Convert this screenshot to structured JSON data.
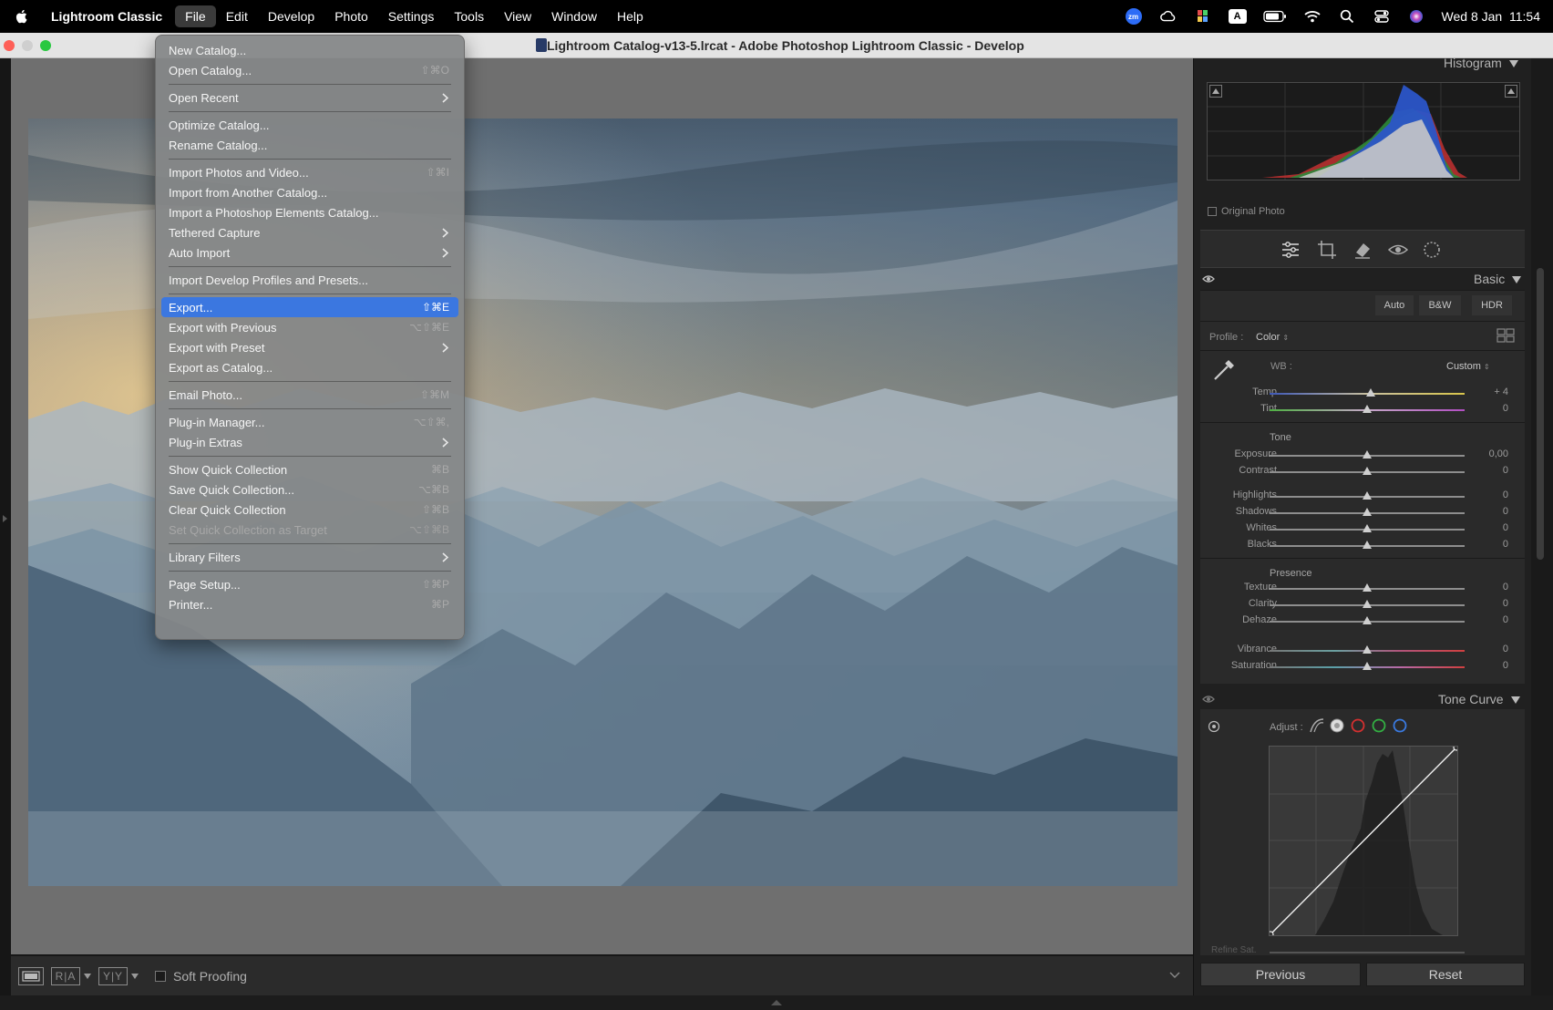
{
  "menubar": {
    "app_name": "Lightroom Classic",
    "items": [
      "File",
      "Edit",
      "Develop",
      "Photo",
      "Settings",
      "Tools",
      "View",
      "Window",
      "Help"
    ],
    "active_item": "File",
    "status_icons": [
      "zoom-icon",
      "creative-cloud-icon",
      "color-app-icon",
      "input-source-icon",
      "battery-icon",
      "wifi-icon",
      "spotlight-search-icon",
      "control-center-icon",
      "siri-icon"
    ],
    "input_source_label": "A",
    "zoom_label": "zm",
    "clock": "Wed 8 Jan  11:54"
  },
  "window": {
    "title": "Lightroom Catalog-v13-5.lrcat - Adobe Photoshop Lightroom Classic - Develop"
  },
  "file_menu": {
    "groups": [
      [
        {
          "label": "New Catalog...",
          "shortcut": ""
        },
        {
          "label": "Open Catalog...",
          "shortcut": "⇧⌘O"
        }
      ],
      [
        {
          "label": "Open Recent",
          "shortcut": "",
          "submenu": true
        }
      ],
      [
        {
          "label": "Optimize Catalog...",
          "shortcut": ""
        },
        {
          "label": "Rename Catalog...",
          "shortcut": ""
        }
      ],
      [
        {
          "label": "Import Photos and Video...",
          "shortcut": "⇧⌘I"
        },
        {
          "label": "Import from Another Catalog...",
          "shortcut": ""
        },
        {
          "label": "Import a Photoshop Elements Catalog...",
          "shortcut": ""
        },
        {
          "label": "Tethered Capture",
          "shortcut": "",
          "submenu": true
        },
        {
          "label": "Auto Import",
          "shortcut": "",
          "submenu": true
        }
      ],
      [
        {
          "label": "Import Develop Profiles and Presets...",
          "shortcut": ""
        }
      ],
      [
        {
          "label": "Export...",
          "shortcut": "⇧⌘E",
          "highlighted": true
        },
        {
          "label": "Export with Previous",
          "shortcut": "⌥⇧⌘E"
        },
        {
          "label": "Export with Preset",
          "shortcut": "",
          "submenu": true
        },
        {
          "label": "Export as Catalog...",
          "shortcut": ""
        }
      ],
      [
        {
          "label": "Email Photo...",
          "shortcut": "⇧⌘M"
        }
      ],
      [
        {
          "label": "Plug-in Manager...",
          "shortcut": "⌥⇧⌘,"
        },
        {
          "label": "Plug-in Extras",
          "shortcut": "",
          "submenu": true
        }
      ],
      [
        {
          "label": "Show Quick Collection",
          "shortcut": "⌘B"
        },
        {
          "label": "Save Quick Collection...",
          "shortcut": "⌥⌘B"
        },
        {
          "label": "Clear Quick Collection",
          "shortcut": "⇧⌘B"
        },
        {
          "label": "Set Quick Collection as Target",
          "shortcut": "⌥⇧⌘B",
          "disabled": true
        }
      ],
      [
        {
          "label": "Library Filters",
          "shortcut": "",
          "submenu": true
        }
      ],
      [
        {
          "label": "Page Setup...",
          "shortcut": "⇧⌘P"
        },
        {
          "label": "Printer...",
          "shortcut": "⌘P"
        }
      ]
    ]
  },
  "histogram": {
    "title": "Histogram",
    "original_photo_label": "Original Photo"
  },
  "basic": {
    "title": "Basic",
    "buttons": [
      "Auto",
      "B&W",
      "HDR"
    ],
    "profile_label": "Profile :",
    "profile_value": "Color",
    "wb_label": "WB :",
    "wb_value": "Custom",
    "tone_label": "Tone",
    "presence_label": "Presence",
    "sliders": [
      {
        "label": "Temp",
        "value": "+ 4",
        "pos": 0.52
      },
      {
        "label": "Tint",
        "value": "0",
        "pos": 0.5
      },
      {
        "label": "Exposure",
        "value": "0,00",
        "pos": 0.5
      },
      {
        "label": "Contrast",
        "value": "0",
        "pos": 0.5
      },
      {
        "label": "Highlights",
        "value": "0",
        "pos": 0.5
      },
      {
        "label": "Shadows",
        "value": "0",
        "pos": 0.5
      },
      {
        "label": "Whites",
        "value": "0",
        "pos": 0.5
      },
      {
        "label": "Blacks",
        "value": "0",
        "pos": 0.5
      },
      {
        "label": "Texture",
        "value": "0",
        "pos": 0.5
      },
      {
        "label": "Clarity",
        "value": "0",
        "pos": 0.5
      },
      {
        "label": "Dehaze",
        "value": "0",
        "pos": 0.5
      },
      {
        "label": "Vibrance",
        "value": "0",
        "pos": 0.5
      },
      {
        "label": "Saturation",
        "value": "0",
        "pos": 0.5
      }
    ]
  },
  "tone_curve": {
    "title": "Tone Curve",
    "adjust_label": "Adjust :",
    "refine_label": "Refine Sat."
  },
  "buttons": {
    "previous": "Previous",
    "reset": "Reset"
  },
  "toolbar": {
    "ra_label": "R|A",
    "yy_label": "Y|Y",
    "soft_proofing": "Soft Proofing"
  }
}
